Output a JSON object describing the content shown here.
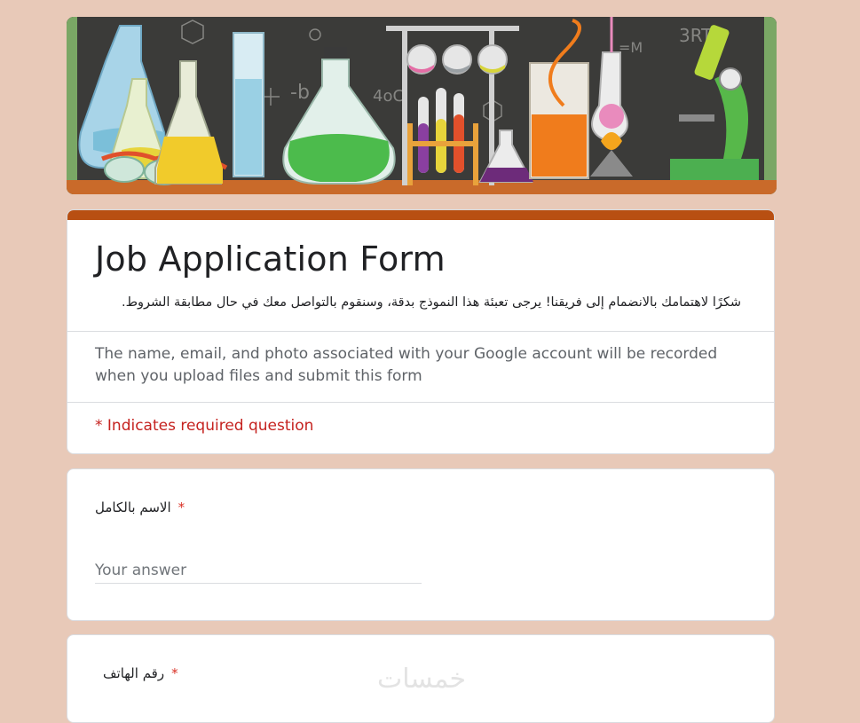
{
  "form": {
    "title": "Job Application Form",
    "description": "شكرًا لاهتمامك بالانضمام إلى فريقنا! يرجى تعبئة هذا النموذج بدقة، وسنقوم بالتواصل معك في حال مطابقة الشروط.",
    "account_notice": "The name, email, and photo associated with your Google account will be recorded when you upload files and submit this form",
    "required_note": "* Indicates required question"
  },
  "questions": [
    {
      "label": "الاسم بالكامل",
      "required_mark": "*",
      "placeholder": "Your answer"
    },
    {
      "label": "رقم الهاتف",
      "required_mark": "*"
    }
  ],
  "watermark": "خمسات",
  "colors": {
    "accent": "#b84f12",
    "background": "#e8c9b8",
    "required": "#d93025"
  }
}
